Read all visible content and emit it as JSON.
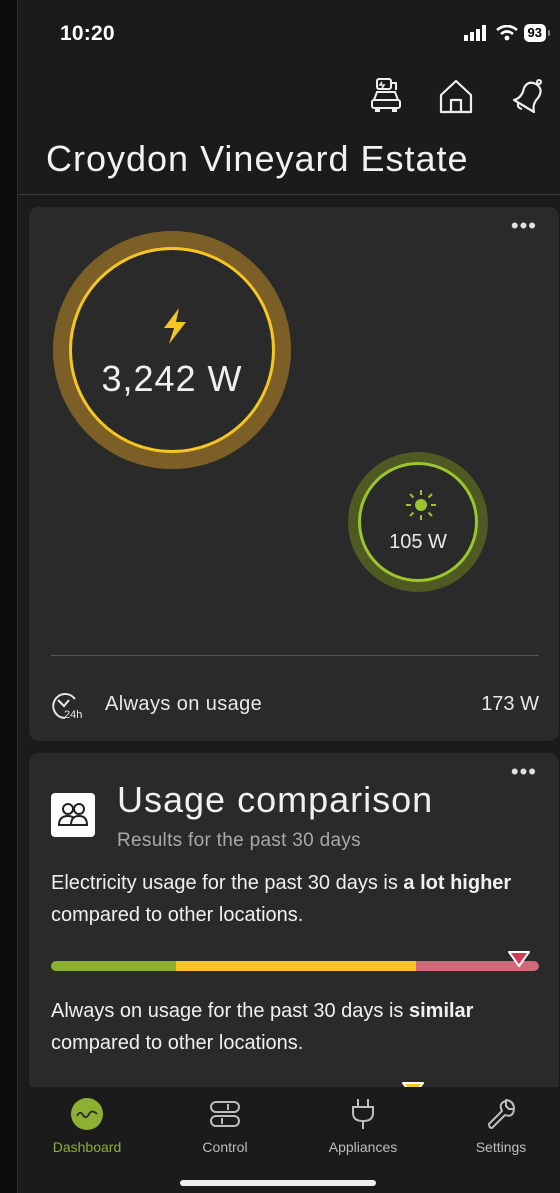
{
  "status_bar": {
    "time": "10:20",
    "battery": "93"
  },
  "header": {
    "title": "Croydon Vineyard Estate",
    "icons": [
      "ev-charger-icon",
      "home-icon",
      "bell-icon"
    ]
  },
  "power_card": {
    "more_label": "•••",
    "consumption": {
      "value": "3,242 W",
      "icon": "lightning-bolt-icon",
      "color": "#f5c524"
    },
    "solar": {
      "value": "105 W",
      "icon": "sun-icon",
      "color": "#9bc52c"
    },
    "always_on": {
      "label": "Always on usage",
      "value": "173 W",
      "icon": "clock-24h-icon"
    }
  },
  "comparison_card": {
    "more_label": "•••",
    "title": "Usage comparison",
    "subtitle": "Results for the past 30 days",
    "electricity": {
      "text_before": "Electricity usage for the past 30 days is ",
      "emphasis": "a lot higher",
      "text_after": " compared to other locations."
    },
    "always_on": {
      "text_before": "Always on usage for the past 30 days is ",
      "emphasis": "similar",
      "text_after": " compared to other locations."
    },
    "scale_colors": {
      "low": "#8db032",
      "mid": "#f5c524",
      "high": "#d06a7a"
    }
  },
  "nav": {
    "items": [
      {
        "label": "Dashboard",
        "icon": "dashboard-icon",
        "active": true
      },
      {
        "label": "Control",
        "icon": "toggle-icon",
        "active": false
      },
      {
        "label": "Appliances",
        "icon": "plug-icon",
        "active": false
      },
      {
        "label": "Settings",
        "icon": "wrench-icon",
        "active": false
      }
    ]
  }
}
